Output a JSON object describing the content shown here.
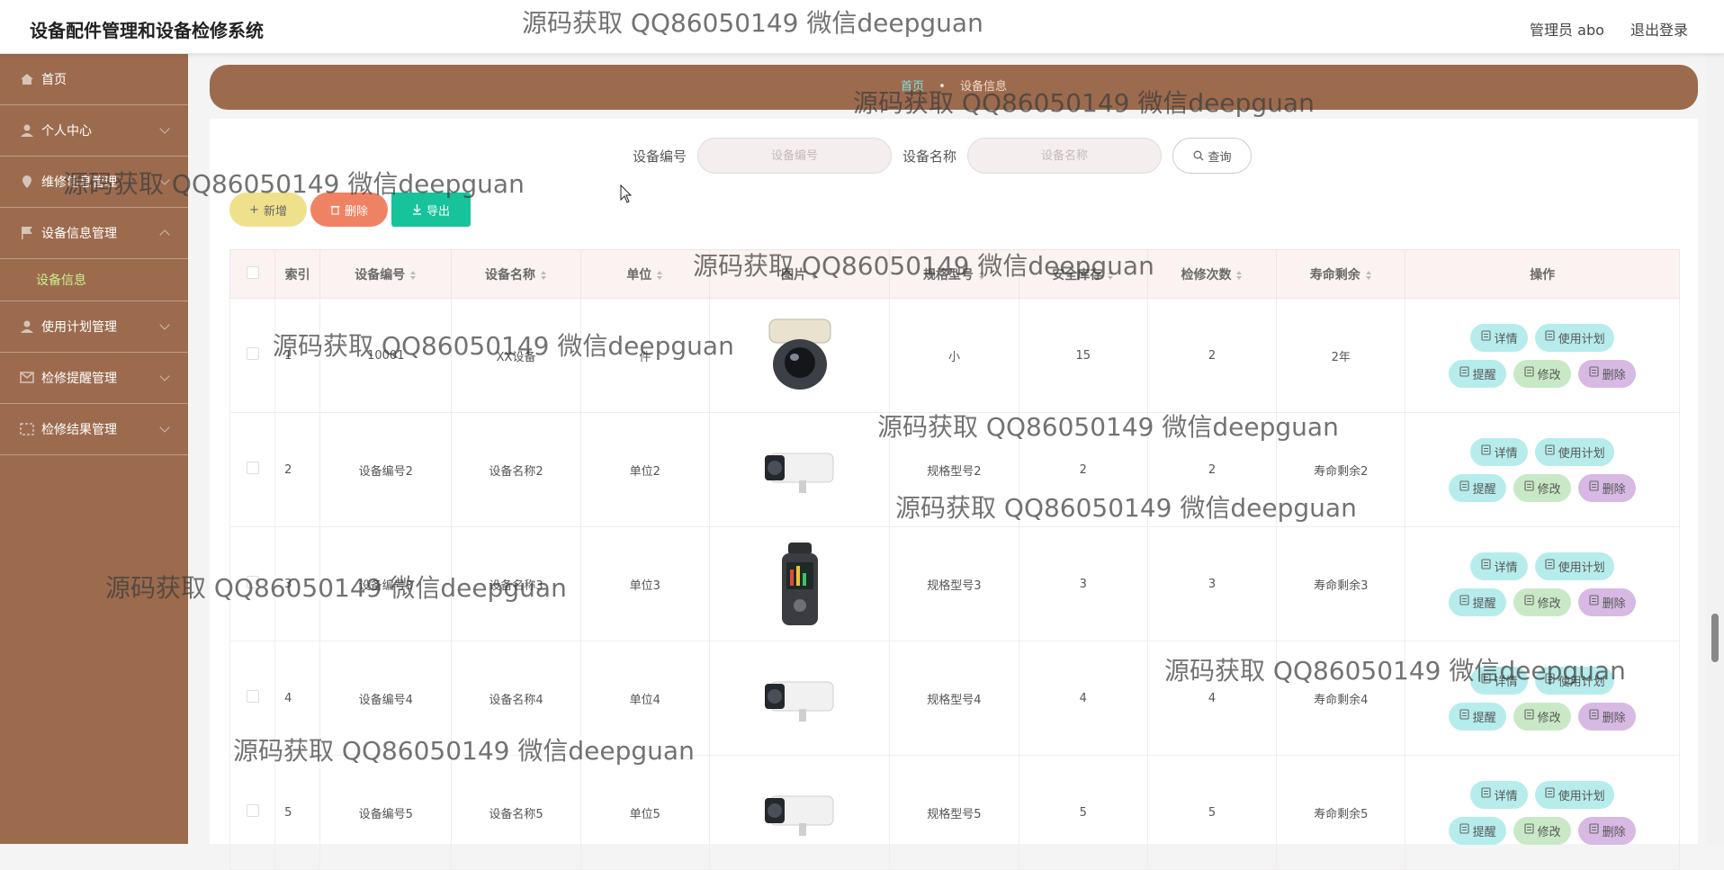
{
  "header": {
    "title": "设备配件管理和设备检修系统",
    "user": "管理员 abo",
    "logout": "退出登录"
  },
  "sidebar": {
    "items": [
      {
        "label": "首页"
      },
      {
        "label": "个人中心"
      },
      {
        "label": "维修信息管理"
      },
      {
        "label": "设备信息管理"
      },
      {
        "label": "使用计划管理"
      },
      {
        "label": "检修提醒管理"
      },
      {
        "label": "检修结果管理"
      }
    ],
    "active_submenu": "设备信息"
  },
  "breadcrumb": {
    "home": "首页",
    "sep": "•",
    "current": "设备信息"
  },
  "search": {
    "label1": "设备编号",
    "placeholder1": "设备编号",
    "label2": "设备名称",
    "placeholder2": "设备名称",
    "query": "查询"
  },
  "actions": {
    "add": "新增",
    "delete": "删除",
    "export": "导出"
  },
  "table": {
    "headers": [
      "索引",
      "设备编号",
      "设备名称",
      "单位",
      "图片",
      "规格型号",
      "安全库存",
      "检修次数",
      "寿命剩余",
      "操作"
    ],
    "rows": [
      {
        "idx": "1",
        "code": "10001",
        "name": "XX设备",
        "unit": "件",
        "img": "dome-camera",
        "spec": "小",
        "stock": "15",
        "times": "2",
        "life": "2年"
      },
      {
        "idx": "2",
        "code": "设备编号2",
        "name": "设备名称2",
        "unit": "单位2",
        "img": "bullet-camera",
        "spec": "规格型号2",
        "stock": "2",
        "times": "2",
        "life": "寿命剩余2"
      },
      {
        "idx": "3",
        "code": "设备编号3",
        "name": "设备名称3",
        "unit": "单位3",
        "img": "recorder-device",
        "spec": "规格型号3",
        "stock": "3",
        "times": "3",
        "life": "寿命剩余3"
      },
      {
        "idx": "4",
        "code": "设备编号4",
        "name": "设备名称4",
        "unit": "单位4",
        "img": "bullet-camera",
        "spec": "规格型号4",
        "stock": "4",
        "times": "4",
        "life": "寿命剩余4"
      },
      {
        "idx": "5",
        "code": "设备编号5",
        "name": "设备名称5",
        "unit": "单位5",
        "img": "bullet-camera",
        "spec": "规格型号5",
        "stock": "5",
        "times": "5",
        "life": "寿命剩余5"
      }
    ],
    "row_actions": {
      "detail": "详情",
      "plan": "使用计划",
      "remind": "提醒",
      "edit": "修改",
      "delete": "删除"
    }
  },
  "watermark": "源码获取 QQ86050149 微信deepguan",
  "colors": {
    "sidebar": "#9c6b4e",
    "accent_green": "#17c39a",
    "active_submenu": "#c9f08c"
  }
}
